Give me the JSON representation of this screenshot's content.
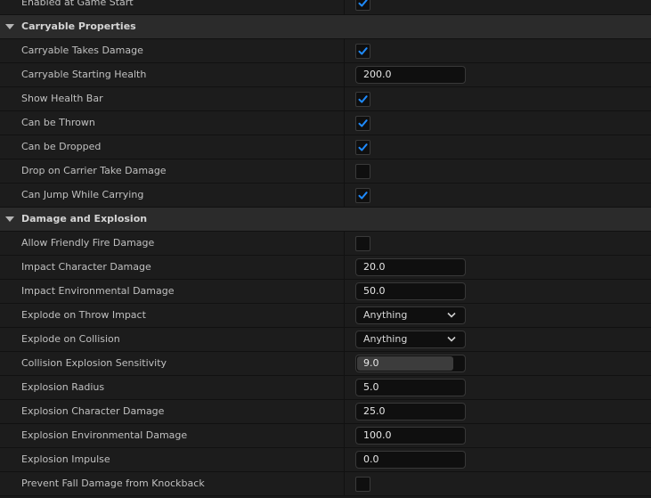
{
  "colors": {
    "accent": "#1f8bff",
    "panel_bg": "#1c1c1c",
    "section_bg": "#2b2b2b"
  },
  "top_row": {
    "label": "Enabled at Game Start",
    "checked": true
  },
  "sections": [
    {
      "title": "Carryable Properties",
      "rows": [
        {
          "label": "Carryable Takes Damage",
          "type": "checkbox",
          "checked": true
        },
        {
          "label": "Carryable Starting Health",
          "type": "number",
          "value": "200.0"
        },
        {
          "label": "Show Health Bar",
          "type": "checkbox",
          "checked": true
        },
        {
          "label": "Can be Thrown",
          "type": "checkbox",
          "checked": true
        },
        {
          "label": "Can be Dropped",
          "type": "checkbox",
          "checked": true
        },
        {
          "label": "Drop on Carrier Take Damage",
          "type": "checkbox",
          "checked": false
        },
        {
          "label": "Can Jump While Carrying",
          "type": "checkbox",
          "checked": true
        }
      ]
    },
    {
      "title": "Damage and Explosion",
      "rows": [
        {
          "label": "Allow Friendly Fire Damage",
          "type": "checkbox",
          "checked": false
        },
        {
          "label": "Impact Character Damage",
          "type": "number",
          "value": "20.0"
        },
        {
          "label": "Impact Environmental Damage",
          "type": "number",
          "value": "50.0"
        },
        {
          "label": "Explode on Throw Impact",
          "type": "dropdown",
          "value": "Anything"
        },
        {
          "label": "Explode on Collision",
          "type": "dropdown",
          "value": "Anything"
        },
        {
          "label": "Collision Explosion Sensitivity",
          "type": "slider",
          "value": "9.0",
          "fill": 0.9
        },
        {
          "label": "Explosion Radius",
          "type": "number",
          "value": "5.0"
        },
        {
          "label": "Explosion Character Damage",
          "type": "number",
          "value": "25.0"
        },
        {
          "label": "Explosion Environmental Damage",
          "type": "number",
          "value": "100.0"
        },
        {
          "label": "Explosion Impulse",
          "type": "number",
          "value": "0.0"
        },
        {
          "label": "Prevent Fall Damage from Knockback",
          "type": "checkbox",
          "checked": false
        }
      ]
    }
  ]
}
